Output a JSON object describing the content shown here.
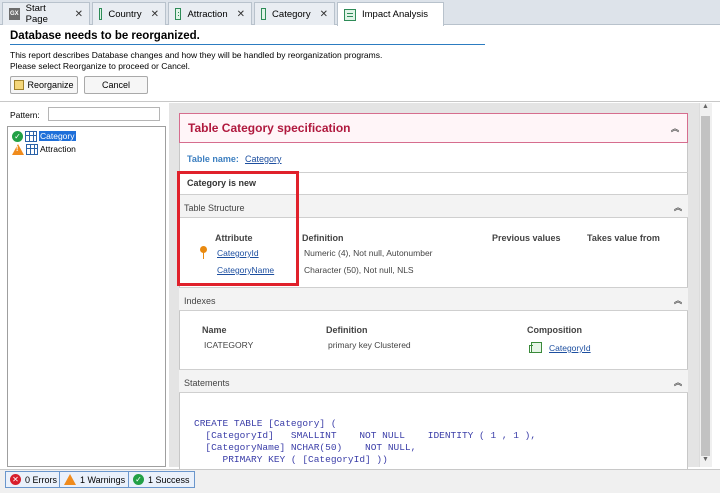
{
  "tabs": [
    {
      "label": "Start Page",
      "icon": "gx-icon"
    },
    {
      "label": "Country",
      "icon": "transaction-icon"
    },
    {
      "label": "Attraction",
      "icon": "transaction-icon"
    },
    {
      "label": "Category",
      "icon": "transaction-icon"
    },
    {
      "label": "Impact Analysis",
      "icon": "impact-analysis-icon"
    }
  ],
  "header": {
    "title": "Database needs to be reorganized.",
    "description_line1": "This report describes Database changes and how they will be handled by reorganization programs.",
    "description_line2": "Please select Reorganize to proceed or Cancel.",
    "reorganize_label": "Reorganize",
    "cancel_label": "Cancel"
  },
  "left_panel": {
    "pattern_label": "Pattern:",
    "pattern_value": "",
    "tree": [
      {
        "label": "Category",
        "status": "success",
        "selected": true
      },
      {
        "label": "Attraction",
        "status": "warning",
        "selected": false
      }
    ]
  },
  "report": {
    "title": "Table Category specification",
    "table_name_label": "Table name:",
    "table_name_value": "Category",
    "status_message": "Category is new",
    "structure": {
      "section_label": "Table Structure",
      "headers": [
        "Attribute",
        "Definition",
        "Previous values",
        "Takes value from"
      ],
      "rows": [
        {
          "attribute": "CategoryId",
          "definition": "Numeric (4), Not null, Autonumber",
          "is_key": true
        },
        {
          "attribute": "CategoryName",
          "definition": "Character (50), Not null, NLS",
          "is_key": false
        }
      ]
    },
    "indexes": {
      "section_label": "Indexes",
      "headers": [
        "Name",
        "Definition",
        "Composition"
      ],
      "rows": [
        {
          "name": "ICATEGORY",
          "definition": "primary key Clustered",
          "composition": "CategoryId"
        }
      ]
    },
    "statements": {
      "section_label": "Statements",
      "code_lines": [
        "CREATE TABLE [Category] (",
        "  [CategoryId]   SMALLINT    NOT NULL    IDENTITY ( 1 , 1 ),",
        "  [CategoryName] NCHAR(50)    NOT NULL,",
        "     PRIMARY KEY ( [CategoryId] ))"
      ]
    }
  },
  "status_bar": {
    "errors": "0 Errors",
    "warnings": "1 Warnings",
    "success": "1 Success"
  },
  "colors": {
    "accent": "#2c7cc1",
    "title_red": "#b0193e",
    "highlight_box": "#e0212b",
    "success_green": "#22a046",
    "warning_orange": "#f08b1c",
    "error_red": "#d81e2c"
  }
}
